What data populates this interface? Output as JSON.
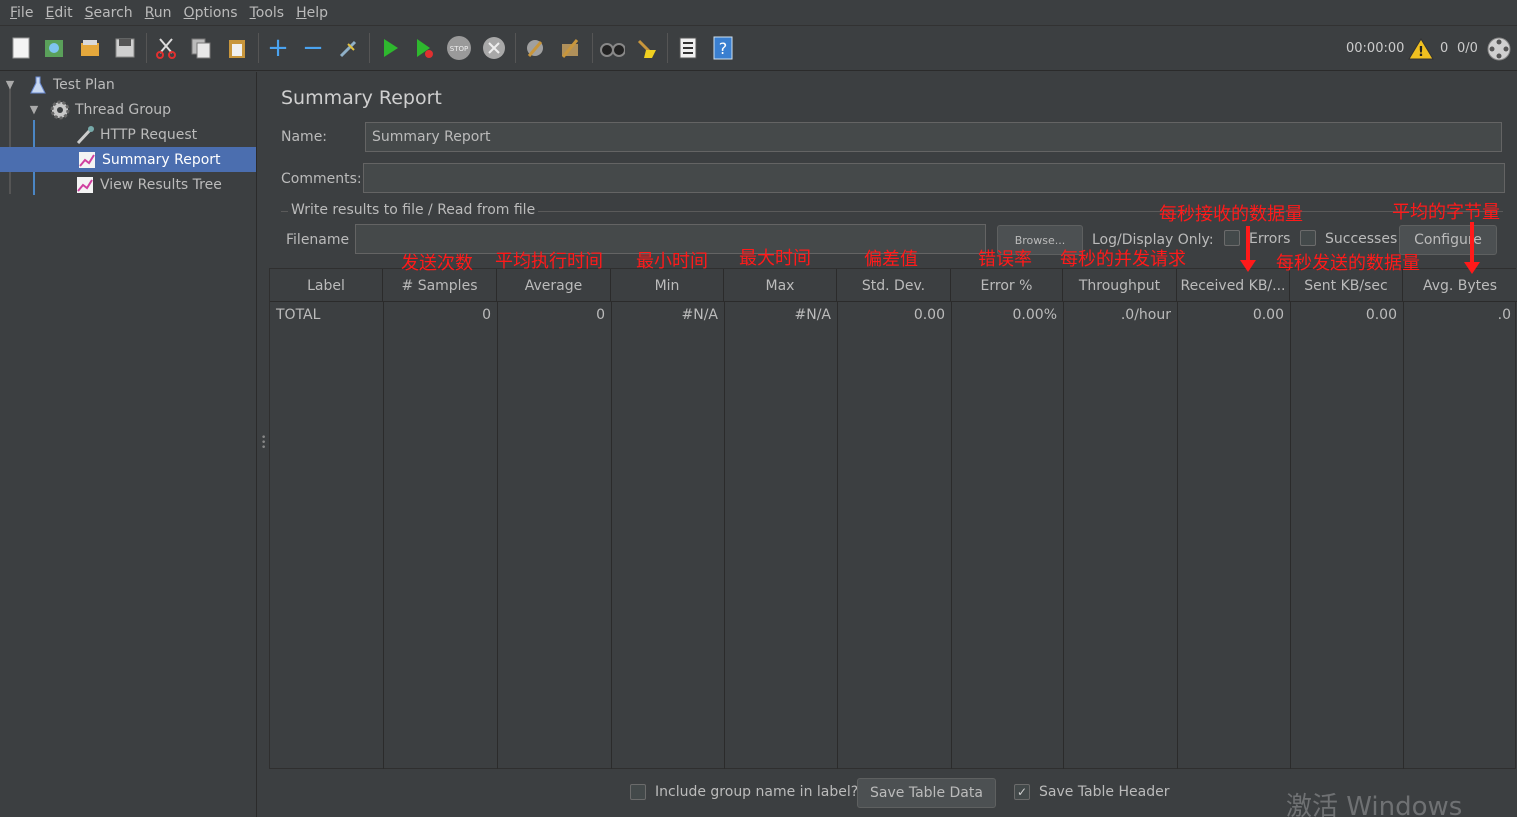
{
  "menu": [
    {
      "key": "F",
      "rest": "ile"
    },
    {
      "key": "E",
      "rest": "dit"
    },
    {
      "key": "S",
      "rest": "earch"
    },
    {
      "key": "R",
      "rest": "un"
    },
    {
      "key": "O",
      "rest": "ptions"
    },
    {
      "key": "T",
      "rest": "ools"
    },
    {
      "key": "H",
      "rest": "elp"
    }
  ],
  "toolbar": {
    "timer": "00:00:00",
    "warning_count": "0",
    "threads": "0/0",
    "icons": [
      "new-icon",
      "templates-icon",
      "open-icon",
      "save-icon",
      "cut-icon",
      "copy-icon",
      "paste-icon",
      "expand-icon",
      "collapse-icon",
      "toggle-icon",
      "start-icon",
      "start-no-pauses-icon",
      "stop-icon",
      "shutdown-icon",
      "clear-icon",
      "clear-all-icon",
      "search-icon",
      "reset-search-icon",
      "function-helper-icon",
      "help-icon"
    ]
  },
  "tree": {
    "items": [
      {
        "label": "Test Plan",
        "icon": "flask-icon"
      },
      {
        "label": "Thread Group",
        "icon": "gear-icon"
      },
      {
        "label": "HTTP Request",
        "icon": "pipette-icon"
      },
      {
        "label": "Summary Report",
        "icon": "chart-icon"
      },
      {
        "label": "View Results Tree",
        "icon": "chart-icon"
      }
    ]
  },
  "panel": {
    "title": "Summary Report",
    "name_label": "Name:",
    "name_value": "Summary Report",
    "comments_label": "Comments:",
    "comments_value": "",
    "group_title": "Write results to file / Read from file",
    "filename_label": "Filename",
    "filename_value": "",
    "browse_label": "Browse...",
    "log_display_label": "Log/Display Only:",
    "errors_label": "Errors",
    "successes_label": "Successes",
    "configure_label": "Configure"
  },
  "table": {
    "headers": [
      "Label",
      "# Samples",
      "Average",
      "Min",
      "Max",
      "Std. Dev.",
      "Error %",
      "Throughput",
      "Received KB/...",
      "Sent KB/sec",
      "Avg. Bytes"
    ],
    "rows": [
      [
        "TOTAL",
        "0",
        "0",
        "#N/A",
        "#N/A",
        "0.00",
        "0.00%",
        ".0/hour",
        "0.00",
        "0.00",
        ".0"
      ]
    ]
  },
  "footer": {
    "include_group_label": "Include group name in label?",
    "save_table_data": "Save Table Data",
    "save_table_header": "Save Table Header"
  },
  "annotations": {
    "samples": "发送次数",
    "average": "平均执行时间",
    "min": "最小时间",
    "max": "最大时间",
    "stddev": "偏差值",
    "error": "错误率",
    "throughput": "每秒的并发请求",
    "received": "每秒接收的数据量",
    "sent": "每秒发送的数据量",
    "avg_bytes": "平均的字节量"
  },
  "watermark": "激活 Windows",
  "colors": {
    "background": "#3c3f41",
    "selection": "#4b6eaf",
    "annotation": "#ff1a1a"
  }
}
